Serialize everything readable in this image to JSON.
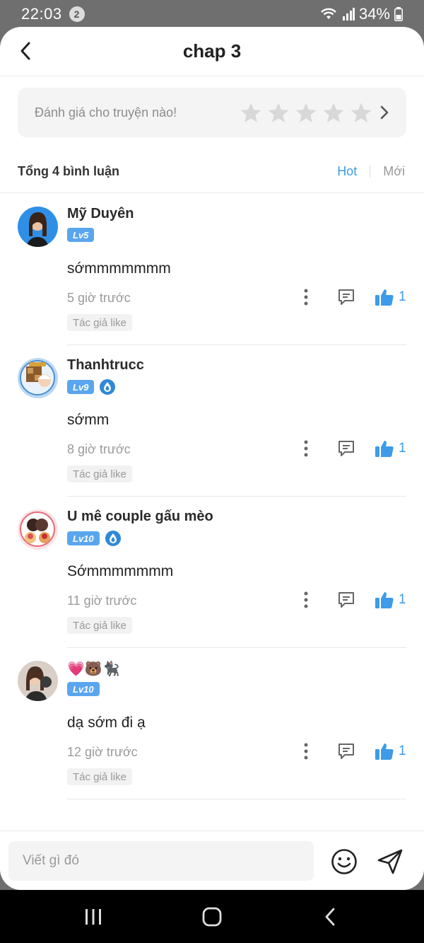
{
  "status_bar": {
    "time": "22:03",
    "notification_count": "2",
    "battery": "34%"
  },
  "header": {
    "title": "chap 3"
  },
  "rating": {
    "prompt": "Đánh giá cho truyện nào!",
    "stars_total": 5,
    "stars_filled": 0
  },
  "summary": {
    "count_label": "Tổng 4 bình luận",
    "tabs": [
      {
        "label": "Hot",
        "active": true
      },
      {
        "label": "Mới",
        "active": false
      }
    ]
  },
  "comments": [
    {
      "username": "Mỹ Duyên",
      "level": "Lv5",
      "has_vip": false,
      "text": "sớmmmmmmm",
      "time": "5 giờ trước",
      "likes": "1",
      "author_like": "Tác giả like"
    },
    {
      "username": "Thanhtrucc",
      "level": "Lv9",
      "has_vip": true,
      "text": "sớmm",
      "time": "8 giờ trước",
      "likes": "1",
      "author_like": "Tác giả like"
    },
    {
      "username": "U mê couple gấu mèo",
      "level": "Lv10",
      "has_vip": true,
      "text": "Sớmmmmmmm",
      "time": "11 giờ trước",
      "likes": "1",
      "author_like": "Tác giả like"
    },
    {
      "username": "💗🐻🐈‍⬛",
      "level": "Lv10",
      "has_vip": false,
      "text": "dạ sớm đi ạ",
      "time": "12 giờ trước",
      "likes": "1",
      "author_like": "Tác giả like"
    }
  ],
  "input": {
    "placeholder": "Viết gì đó"
  },
  "colors": {
    "accent": "#3d9be9",
    "level_badge": "#5aa6ee",
    "star_empty": "#d8d8d8"
  }
}
